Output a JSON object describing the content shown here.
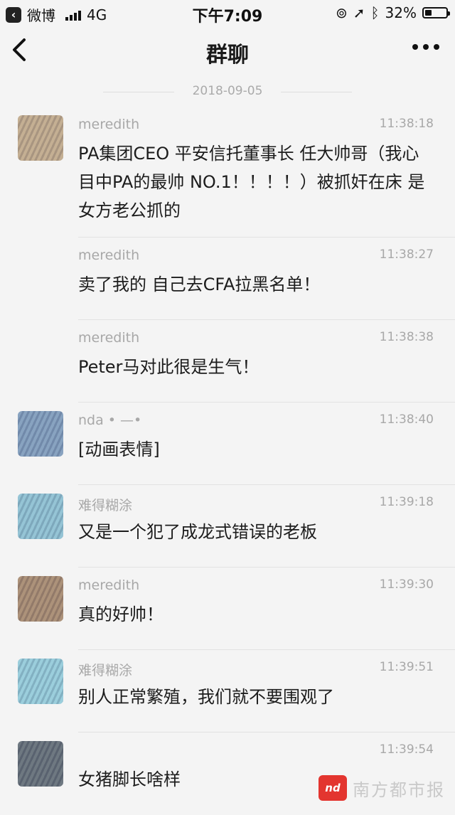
{
  "status_bar": {
    "back_app": "微博",
    "network": "4G",
    "time": "下午7:09",
    "battery": "32%",
    "battery_level": 0.32
  },
  "nav": {
    "title": "群聊"
  },
  "date_divider": "2018-09-05",
  "messages": [
    {
      "sender": "meredith",
      "time": "11:38:18",
      "text": "PA集团CEO 平安信托董事长 任大帅哥（我心目中PA的最帅 NO.1！！！！）被抓奸在床 是女方老公抓的",
      "avatar_color": "#b79e7c",
      "has_avatar": true
    },
    {
      "sender": "meredith",
      "time": "11:38:27",
      "text": "卖了我的 自己去CFA拉黑名单！",
      "has_avatar": false
    },
    {
      "sender": "meredith",
      "time": "11:38:38",
      "text": "Peter马对此很是生气！",
      "has_avatar": false
    },
    {
      "sender": "nda • —•",
      "time": "11:38:40",
      "text": "[动画表情]",
      "avatar_color": "#6f8fb3",
      "has_avatar": true
    },
    {
      "sender": "难得糊涂",
      "time": "11:39:18",
      "text": "又是一个犯了成龙式错误的老板",
      "avatar_color": "#7fb7cc",
      "has_avatar": true
    },
    {
      "sender": "meredith",
      "time": "11:39:30",
      "text": "真的好帅！",
      "avatar_color": "#9b7b5e",
      "has_avatar": true
    },
    {
      "sender": "难得糊涂",
      "time": "11:39:51",
      "text": "别人正常繁殖，我们就不要围观了",
      "avatar_color": "#86c3d4",
      "has_avatar": true
    },
    {
      "sender": "",
      "time": "11:39:54",
      "text": "女猪脚长啥样",
      "avatar_color": "#4f5b66",
      "has_avatar": true
    }
  ],
  "watermark": {
    "logo": "nd",
    "text": "南方都市报"
  }
}
